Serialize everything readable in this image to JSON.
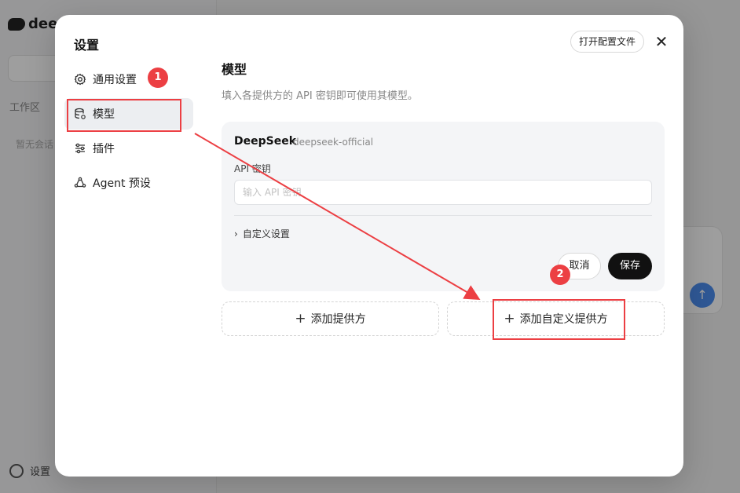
{
  "background": {
    "logo": "dee",
    "section_label": "工作区",
    "empty_label": "暂无会话",
    "settings_label": "设置",
    "send_icon": "arrow-up-icon"
  },
  "modal": {
    "title": "设置",
    "open_config_label": "打开配置文件",
    "close_icon": "close-icon",
    "nav": [
      {
        "label": "通用设置",
        "icon": "gear-icon",
        "active": false
      },
      {
        "label": "模型",
        "icon": "database-icon",
        "active": true
      },
      {
        "label": "插件",
        "icon": "sliders-icon",
        "active": false
      },
      {
        "label": "Agent 预设",
        "icon": "agent-icon",
        "active": false
      }
    ],
    "section": {
      "title": "模型",
      "description": "填入各提供方的 API 密钥即可使用其模型。"
    },
    "provider": {
      "name": "DeepSeek",
      "id": "deepseek-official",
      "key_label": "API 密钥",
      "key_placeholder": "输入 API 密钥",
      "key_value": "",
      "custom_settings_label": "自定义设置",
      "cancel_label": "取消",
      "save_label": "保存"
    },
    "add_provider_label": "添加提供方",
    "add_custom_provider_label": "添加自定义提供方"
  },
  "annotations": {
    "badge_1": "1",
    "badge_2": "2",
    "color": "#ec3f43"
  }
}
